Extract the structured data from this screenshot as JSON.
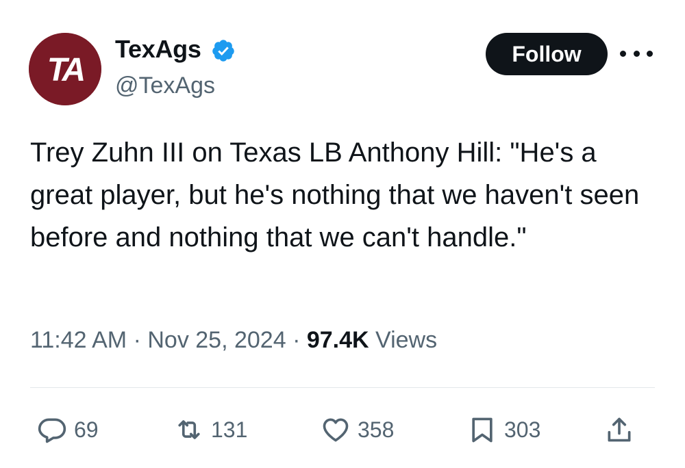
{
  "author": {
    "display_name": "TexAgs",
    "handle": "@TexAgs",
    "avatar_initials": "TA",
    "verified": true
  },
  "follow_label": "Follow",
  "tweet": {
    "text": "Trey Zuhn III on Texas LB Anthony Hill: \"He's a great player, but he's nothing that we haven't seen before and nothing that we can't handle.\""
  },
  "meta": {
    "time": "11:42 AM",
    "date": "Nov 25, 2024",
    "views_count": "97.4K",
    "views_label": "Views"
  },
  "actions": {
    "replies": "69",
    "retweets": "131",
    "likes": "358",
    "bookmarks": "303"
  },
  "colors": {
    "text_primary": "#0f1419",
    "text_secondary": "#536471",
    "verified_blue": "#1d9bf0",
    "avatar_maroon": "#7a1a26",
    "button_black": "#0f1419"
  },
  "icons": [
    "reply-icon",
    "retweet-icon",
    "like-icon",
    "bookmark-icon",
    "share-icon",
    "verified-badge-icon",
    "more-icon"
  ]
}
